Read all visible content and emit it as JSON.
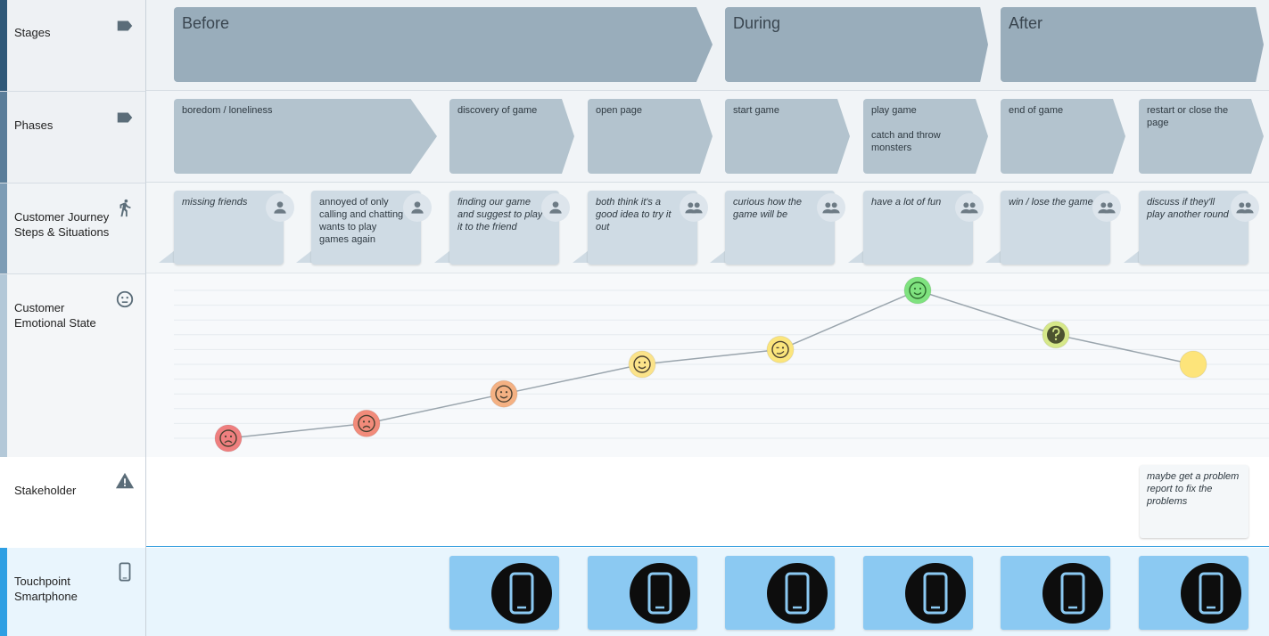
{
  "lanes": [
    {
      "label": "Stages",
      "icon": "label-icon"
    },
    {
      "label": "Phases",
      "icon": "label-icon"
    },
    {
      "label": "Customer Journey Steps & Situations",
      "icon": "walking-person-icon"
    },
    {
      "label": "Customer Emotional State",
      "icon": "neutral-face-icon"
    },
    {
      "label": "Stakeholder",
      "icon": "warning-icon"
    },
    {
      "label": "Touchpoint Smartphone",
      "icon": "smartphone-icon"
    }
  ],
  "stages": [
    {
      "label": "Before"
    },
    {
      "label": "During"
    },
    {
      "label": "After"
    }
  ],
  "phases": [
    {
      "label": "boredom / loneliness"
    },
    {
      "label": "discovery of game"
    },
    {
      "label": "open page"
    },
    {
      "label": "start game"
    },
    {
      "label": "play game\n\ncatch and throw monsters"
    },
    {
      "label": "end of game"
    },
    {
      "label": "restart or close the page"
    }
  ],
  "steps": [
    {
      "text": "missing friends",
      "persona": "single-person-icon"
    },
    {
      "text": "annoyed of only calling and chatting wants to play games again",
      "persona": "single-person-icon"
    },
    {
      "text": "finding our game and suggest to play it to the friend",
      "persona": "single-person-icon"
    },
    {
      "text": "both think it's a good idea to try it out",
      "persona": "group-icon"
    },
    {
      "text": "curious how the game will be",
      "persona": "group-icon"
    },
    {
      "text": "have a lot of fun",
      "persona": "group-icon"
    },
    {
      "text": "win / lose the game",
      "persona": "group-icon"
    },
    {
      "text": "discuss if they'll play another round",
      "persona": "group-icon"
    }
  ],
  "emotions": [
    {
      "level": 1,
      "face": "sad-face-icon",
      "color": "#ef7f7f"
    },
    {
      "level": 2,
      "face": "sad-face-icon",
      "color": "#f28b7a"
    },
    {
      "level": 4,
      "face": "neutral-smile-icon",
      "color": "#f4b183"
    },
    {
      "level": 6,
      "face": "smile-face-icon",
      "color": "#fbe38a"
    },
    {
      "level": 7,
      "face": "wink-face-icon",
      "color": "#fbe57c"
    },
    {
      "level": 11,
      "face": "happy-face-icon",
      "color": "#7fe27f"
    },
    {
      "level": 8,
      "face": "question-icon",
      "color": "#d6e889"
    },
    {
      "level": 6,
      "face": "blank-face",
      "color": "#fde47a"
    }
  ],
  "stakeholder_note": "maybe get a problem report to fix the problems",
  "touchpoints": [
    {
      "icon": "smartphone-icon"
    },
    {
      "icon": "smartphone-icon"
    },
    {
      "icon": "smartphone-icon"
    },
    {
      "icon": "smartphone-icon"
    },
    {
      "icon": "smartphone-icon"
    },
    {
      "icon": "smartphone-icon"
    }
  ],
  "colors": {
    "stage_fill": "#99adbb",
    "phase_fill": "#b3c3ce",
    "step_fill": "#cfdbe4",
    "touchpoint_fill": "#8bc9f2",
    "emotion_line": "#9aa5ad"
  }
}
